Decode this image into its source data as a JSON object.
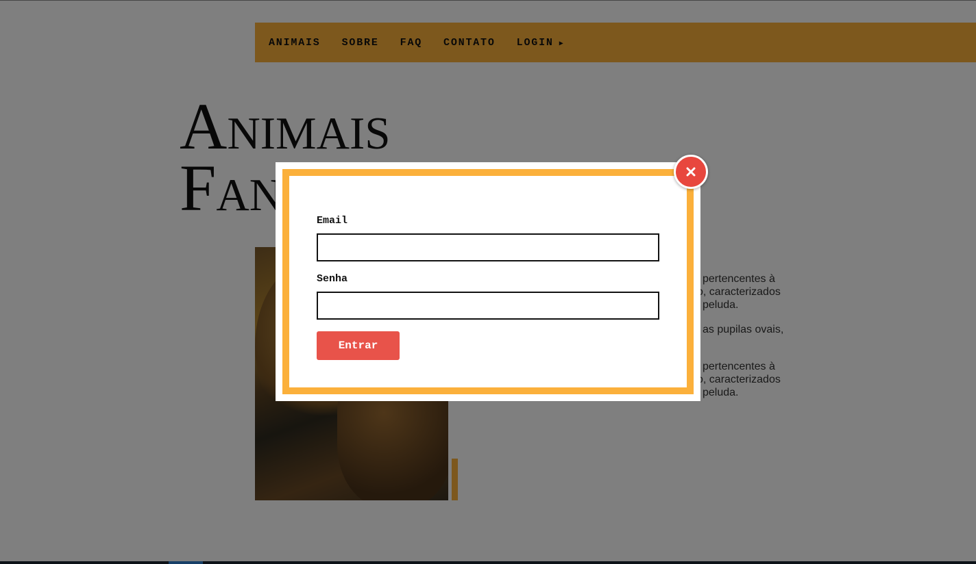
{
  "nav": {
    "items": [
      "ANIMAIS",
      "SOBRE",
      "FAQ",
      "CONTATO",
      "LOGIN"
    ],
    "login_arrow": "▶"
  },
  "hero": {
    "title_line1": "Animais",
    "title_line2": "Fan"
  },
  "description": {
    "p1": [
      "pertencentes à",
      "o, caracterizados",
      "peluda."
    ],
    "p2": [
      "as pupilas ovais,"
    ],
    "p3": [
      "pertencentes à",
      "o, caracterizados",
      "peluda."
    ]
  },
  "modal": {
    "email_label": "Email",
    "email_value": "",
    "password_label": "Senha",
    "password_value": "",
    "submit_label": "Entrar",
    "close_icon": "close-icon"
  },
  "colors": {
    "accent": "#fbb03b",
    "button": "#e8534a",
    "close": "#e8473e"
  }
}
